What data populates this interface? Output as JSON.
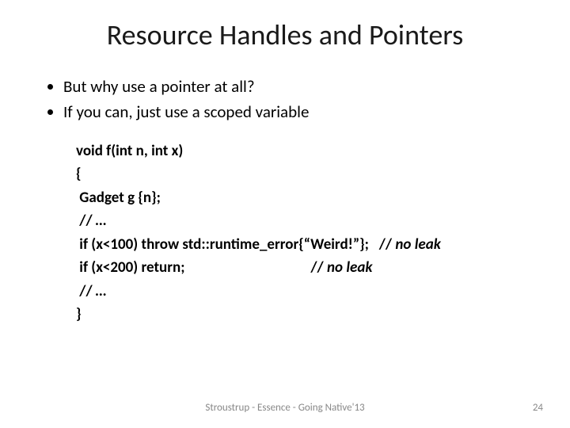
{
  "title": "Resource Handles and Pointers",
  "bullets": [
    "But why use a pointer at all?",
    "If you can, just use a scoped variable"
  ],
  "code": {
    "l1": "void f(int n, int x)",
    "l2": "{",
    "l3": " Gadget g {n};",
    "l4a": " // ",
    "l4b": "…",
    "l5a": " if (x<100) throw std::runtime_error{“Weird!”};   // ",
    "l5b": "no leak",
    "l6a": " if (x<200) return;                                     // ",
    "l6b": "no leak",
    "l7a": " // ",
    "l7b": "…",
    "l8": "}"
  },
  "footer": "Stroustrup - Essence - Going Native'13",
  "page": "24"
}
